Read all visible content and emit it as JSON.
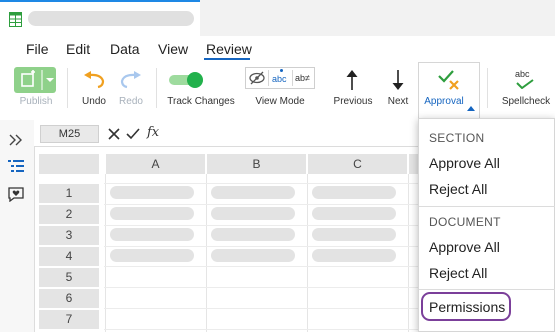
{
  "menu": {
    "file": "File",
    "edit": "Edit",
    "data": "Data",
    "view": "View",
    "review": "Review"
  },
  "ribbon": {
    "publish": "Publish",
    "undo": "Undo",
    "redo": "Redo",
    "track_changes": "Track Changes",
    "view_mode": "View Mode",
    "previous": "Previous",
    "next": "Next",
    "approval": "Approval",
    "spellcheck": "Spellcheck",
    "spell_glyph": "abc",
    "view_mode_abc1": "abc",
    "view_mode_abc2": "ab≠"
  },
  "formula_bar": {
    "cell_ref": "M25",
    "fx": "fx"
  },
  "grid": {
    "columns": [
      "A",
      "B",
      "C"
    ],
    "rows": [
      "1",
      "2",
      "3",
      "4",
      "5",
      "6",
      "7"
    ]
  },
  "approval_menu": {
    "section_header": "SECTION",
    "section_approve": "Approve All",
    "section_reject": "Reject All",
    "document_header": "DOCUMENT",
    "document_approve": "Approve All",
    "document_reject": "Reject All",
    "permissions": "Permissions"
  },
  "colors": {
    "accent": "#1565c0",
    "track_toggle": "#22b14c",
    "permissions_outline": "#7b3f9a",
    "approval_check": "#2e9e3e",
    "approval_x": "#f0a020"
  }
}
